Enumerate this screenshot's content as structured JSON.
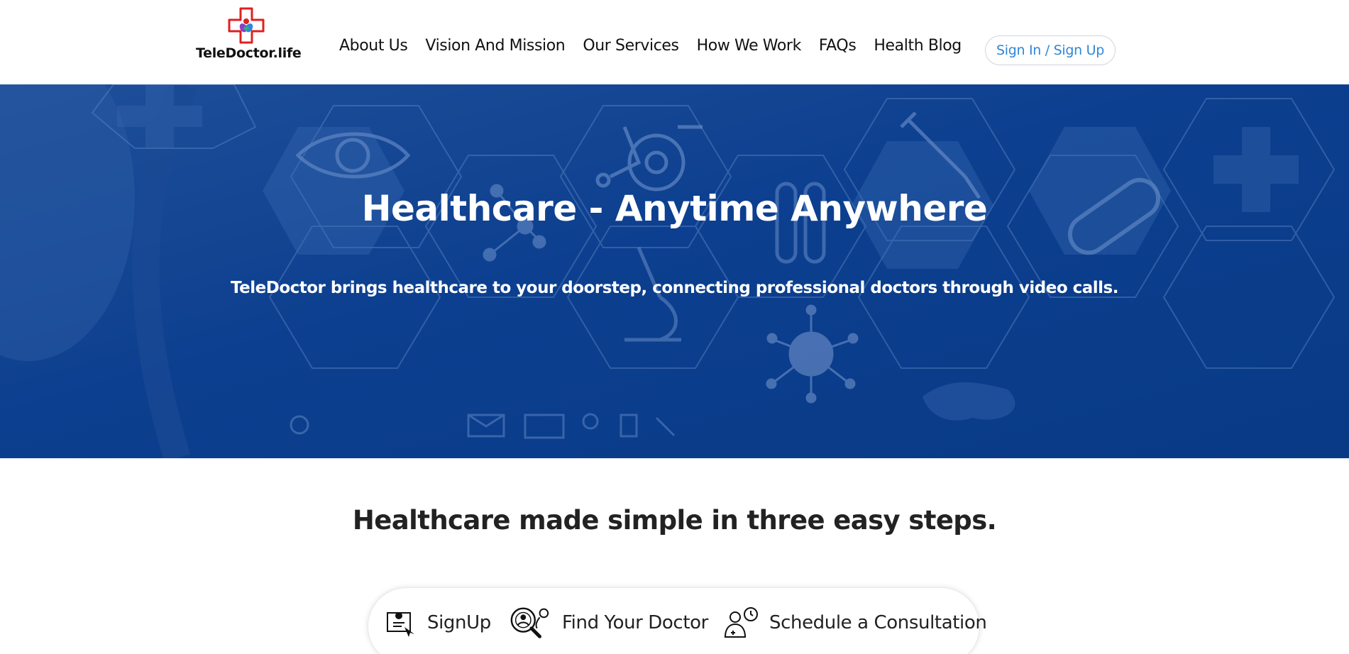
{
  "header": {
    "logo_text": "TeleDoctor.life",
    "nav": [
      {
        "label": "About Us"
      },
      {
        "label": "Vision And Mission"
      },
      {
        "label": "Our Services"
      },
      {
        "label": "How We Work"
      },
      {
        "label": "FAQs"
      },
      {
        "label": "Health Blog"
      }
    ],
    "signin_label": "Sign In / Sign Up"
  },
  "hero": {
    "title": "Healthcare - Anytime Anywhere",
    "subtitle": "TeleDoctor brings healthcare to your doorstep, connecting professional doctors through video calls."
  },
  "steps": {
    "title": "Healthcare made simple in three easy steps.",
    "items": [
      {
        "label": "SignUp",
        "icon": "signup-icon"
      },
      {
        "label": "Find Your Doctor",
        "icon": "find-doctor-icon"
      },
      {
        "label": "Schedule a Consultation",
        "icon": "schedule-consultation-icon"
      }
    ]
  },
  "colors": {
    "hero_bg": "#0b3d8c",
    "accent": "#2f87d8",
    "logo_red": "#e02020"
  }
}
